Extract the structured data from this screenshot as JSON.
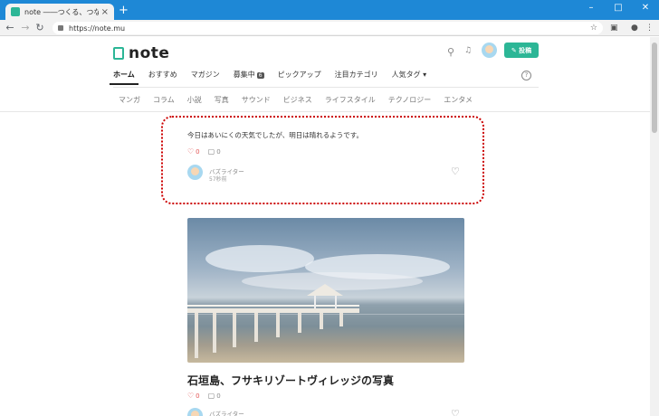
{
  "browser": {
    "tab_title": "note ――つくる、つながる、とどける。",
    "tab_close": "×",
    "new_tab": "+",
    "window_controls": {
      "minimize": "–",
      "maximize": "□",
      "close": "✕"
    },
    "nav": {
      "back": "←",
      "forward": "→",
      "reload": "↻"
    },
    "url": "https://note.mu",
    "bookmark": "☆"
  },
  "header": {
    "logo_text": "note",
    "search_icon": "⚲",
    "bell_icon": "🔔",
    "post_label": "✎ 投稿"
  },
  "global_nav": {
    "items": [
      {
        "label": "ホーム",
        "active": true
      },
      {
        "label": "おすすめ"
      },
      {
        "label": "マガジン"
      },
      {
        "label": "募集中",
        "badge": "6"
      },
      {
        "label": "ピックアップ"
      },
      {
        "label": "注目カテゴリ"
      },
      {
        "label": "人気タグ ▾"
      }
    ],
    "help": "?"
  },
  "categories": [
    "マンガ",
    "コラム",
    "小説",
    "写真",
    "サウンド",
    "ビジネス",
    "ライフスタイル",
    "テクノロジー",
    "エンタメ"
  ],
  "notes": [
    {
      "text": "今日はあいにくの天気でしたが、明日は晴れるようです。",
      "likes": "0",
      "comments": "0",
      "author": "バズライター",
      "time": "57秒前"
    },
    {
      "title": "石垣島、フサキリゾートヴィレッジの写真",
      "likes": "0",
      "comments": "0",
      "author": "バズライター"
    }
  ],
  "colors": {
    "accent": "#2cb696",
    "titlebar": "#1e88d6",
    "highlight": "#cc0000"
  }
}
